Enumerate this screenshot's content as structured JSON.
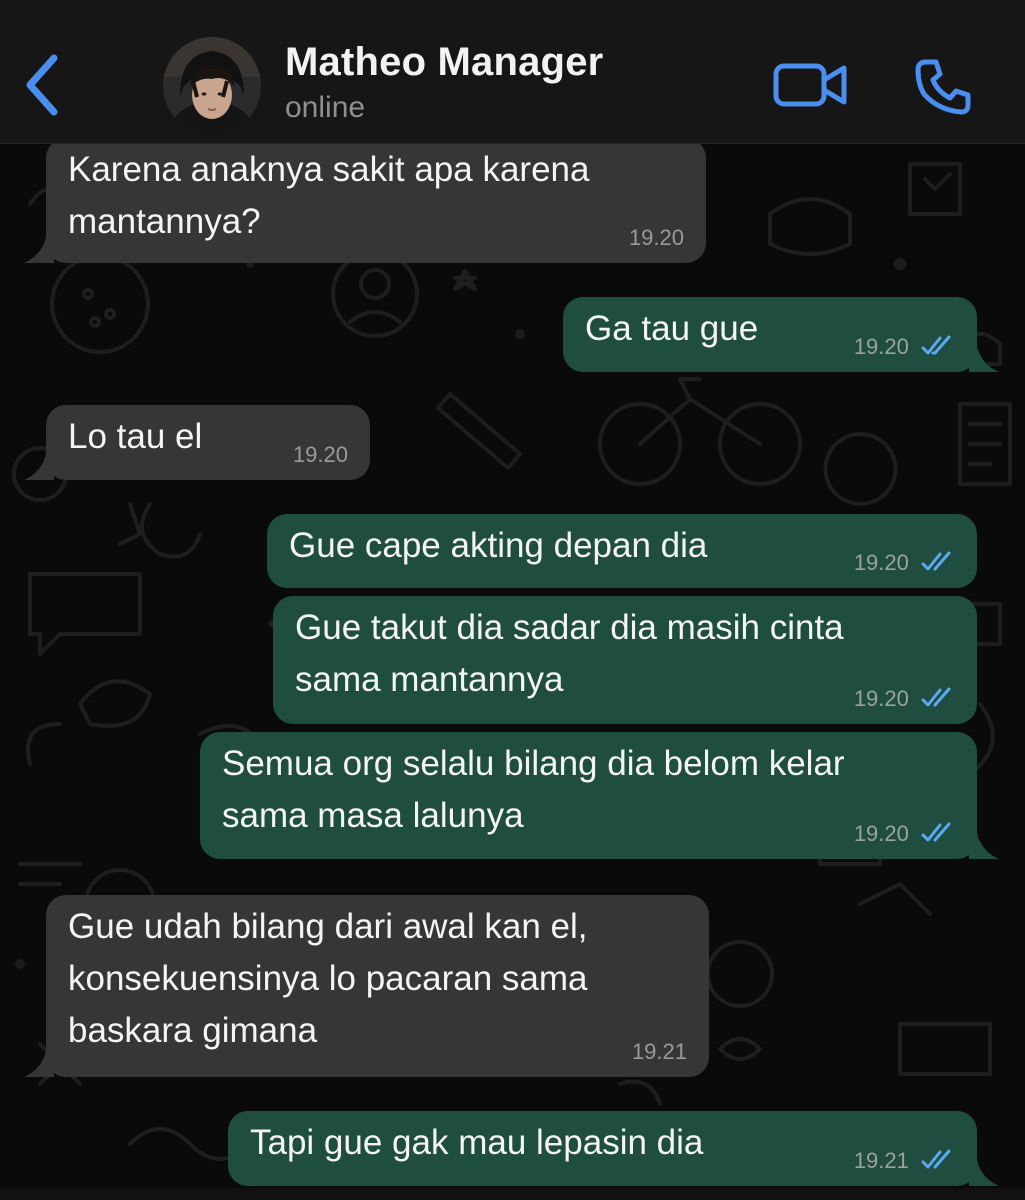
{
  "header": {
    "contact_name": "Matheo Manager",
    "status": "online",
    "back_icon": "chevron-left-icon",
    "video_icon": "video-camera-icon",
    "call_icon": "phone-icon"
  },
  "colors": {
    "accent": "#4a8ff0",
    "incoming_bubble": "#363636",
    "outgoing_bubble": "#1f4d3f",
    "read_ticks": "#5aa9f3"
  },
  "messages": [
    {
      "direction": "incoming",
      "text": "Karena anaknya sakit apa karena\nmantannya?",
      "time": "19.20",
      "read": false
    },
    {
      "direction": "outgoing",
      "text": "Ga tau gue",
      "time": "19.20",
      "read": true
    },
    {
      "direction": "incoming",
      "text": "Lo tau el",
      "time": "19.20",
      "read": false
    },
    {
      "direction": "outgoing",
      "text": "Gue cape akting depan dia",
      "time": "19.20",
      "read": true
    },
    {
      "direction": "outgoing",
      "text": "Gue takut dia sadar dia masih cinta\nsama mantannya",
      "time": "19.20",
      "read": true
    },
    {
      "direction": "outgoing",
      "text": "Semua org selalu bilang dia belom kelar\nsama masa lalunya",
      "time": "19.20",
      "read": true
    },
    {
      "direction": "incoming",
      "text": "Gue udah bilang dari awal kan el,\nkonsekuensinya lo pacaran sama\nbaskara gimana",
      "time": "19.21",
      "read": false
    },
    {
      "direction": "outgoing",
      "text": "Tapi gue gak mau lepasin dia",
      "time": "19.21",
      "read": true
    }
  ]
}
